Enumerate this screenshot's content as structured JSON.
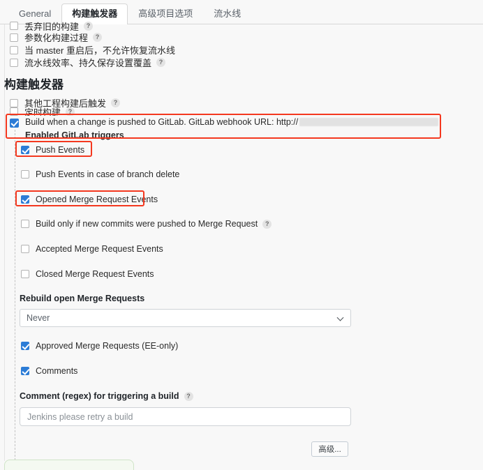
{
  "tabs": [
    {
      "label": "General",
      "active": false
    },
    {
      "label": "构建触发器",
      "active": true
    },
    {
      "label": "高级项目选项",
      "active": false
    },
    {
      "label": "流水线",
      "active": false
    }
  ],
  "top_options": [
    {
      "label": "丢弃旧的构建",
      "checked": false,
      "help": "?",
      "clipped": true
    },
    {
      "label": "参数化构建过程",
      "checked": false,
      "help": "?"
    },
    {
      "label": "当 master 重启后，不允许恢复流水线",
      "checked": false,
      "help": ""
    },
    {
      "label": "流水线效率、持久保存设置覆盖",
      "checked": false,
      "help": "?"
    }
  ],
  "section": {
    "title": "构建触发器"
  },
  "trigger_options": [
    {
      "label": "其他工程构建后触发",
      "checked": false,
      "help": "?"
    },
    {
      "label": "定时构建",
      "checked": false,
      "help": "?"
    }
  ],
  "gitlab": {
    "main_label": "Build when a change is pushed to GitLab. GitLab webhook URL: http://",
    "url_redacted": true,
    "sub_label": "Enabled GitLab triggers",
    "checked": true,
    "help": "?"
  },
  "events": [
    {
      "label": "Push Events",
      "checked": true,
      "help": "",
      "highlighted": true
    },
    {
      "label": "Push Events in case of branch delete",
      "checked": false,
      "help": "",
      "highlighted": false
    },
    {
      "label": "Opened Merge Request Events",
      "checked": true,
      "help": "",
      "highlighted": true
    },
    {
      "label": "Build only if new commits were pushed to Merge Request",
      "checked": false,
      "help": "?",
      "highlighted": false
    },
    {
      "label": "Accepted Merge Request Events",
      "checked": false,
      "help": "",
      "highlighted": false
    },
    {
      "label": "Closed Merge Request Events",
      "checked": false,
      "help": "",
      "highlighted": false
    }
  ],
  "rebuild": {
    "label": "Rebuild open Merge Requests",
    "selected": "Never",
    "options": [
      "Never"
    ]
  },
  "approvals": [
    {
      "label": "Approved Merge Requests (EE-only)",
      "checked": true
    },
    {
      "label": "Comments",
      "checked": true
    }
  ],
  "comment_regex": {
    "label": "Comment (regex) for triggering a build",
    "help": "?",
    "value": "Jenkins please retry a build"
  },
  "advanced_button": {
    "label": "高级..."
  },
  "colors": {
    "accent_checkbox": "#2c7cd6",
    "highlight": "#f4381f",
    "page_bg": "#f8f8f8",
    "text": "#2a2a2a"
  }
}
